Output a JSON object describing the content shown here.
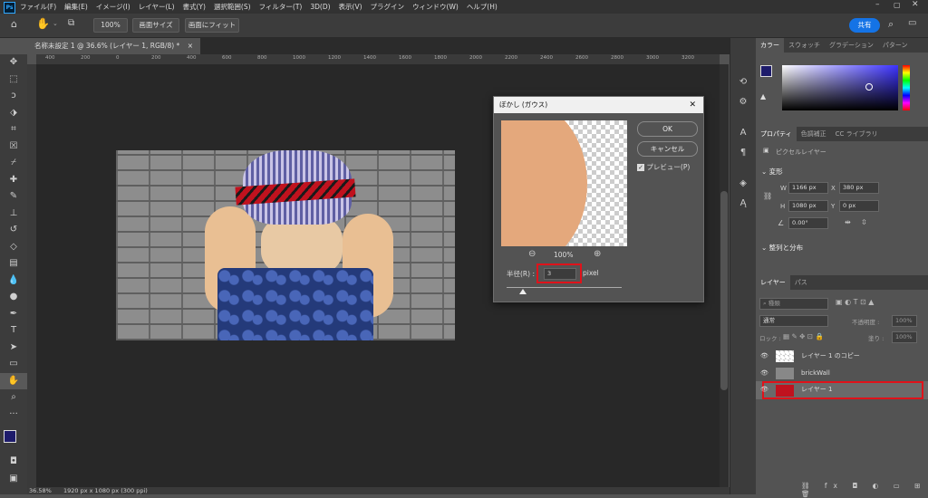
{
  "menubar": {
    "app_icon": "Ps",
    "items": [
      "ファイル(F)",
      "編集(E)",
      "イメージ(I)",
      "レイヤー(L)",
      "書式(Y)",
      "選択範囲(S)",
      "フィルター(T)",
      "3D(D)",
      "表示(V)",
      "プラグイン",
      "ウィンドウ(W)",
      "ヘルプ(H)"
    ]
  },
  "optionsbar": {
    "zoom": "100%",
    "fit_screen": "画面サイズ",
    "fill_screen": "画面にフィット",
    "share": "共有"
  },
  "document": {
    "tab_title": "名称未設定 1 @ 36.6% (レイヤー 1, RGB/8) *",
    "close": "×"
  },
  "ruler": {
    "top_ticks": [
      "400",
      "200",
      "0",
      "200",
      "400",
      "600",
      "800",
      "1000",
      "1200",
      "1400",
      "1600",
      "1800",
      "2000",
      "2200",
      "2400",
      "2600",
      "2800",
      "3000",
      "3200"
    ]
  },
  "status": {
    "zoom": "36.58%",
    "doc_info": "1920 px x 1080 px (300 ppi)"
  },
  "dialog": {
    "title": "ぼかし (ガウス)",
    "close": "✕",
    "ok": "OK",
    "cancel": "キャンセル",
    "preview_label": "プレビュー(P)",
    "preview_checked": true,
    "zoom": "100%",
    "radius_label": "半径(R) :",
    "radius_value": "3",
    "radius_unit": "pixel",
    "slider_value": 3
  },
  "color_panel": {
    "tabs": [
      "カラー",
      "スウォッチ",
      "グラデーション",
      "パターン"
    ],
    "active": "カラー",
    "hue_color": "#3d33ff"
  },
  "properties_panel": {
    "tabs": [
      "プロパティ",
      "色調補正",
      "CC ライブラリ"
    ],
    "type_label": "ピクセルレイヤー",
    "transform_label": "変形",
    "w_label": "W",
    "w_value": "1166 px",
    "h_label": "H",
    "h_value": "1080 px",
    "x_label": "X",
    "x_value": "380 px",
    "y_label": "Y",
    "y_value": "0 px",
    "angle_value": "0.00°",
    "align_label": "整列と分布"
  },
  "layers_panel": {
    "tabs": [
      "レイヤー",
      "パス"
    ],
    "search_placeholder": "種類",
    "blend_mode": "通常",
    "opacity_label": "不透明度 :",
    "opacity_value": "100%",
    "lock_label": "ロック :",
    "fill_label": "塗り :",
    "fill_value": "100%",
    "layers": [
      {
        "name": "レイヤー 1 のコピー",
        "selected": false
      },
      {
        "name": "brickWall",
        "selected": false
      },
      {
        "name": "レイヤー 1",
        "selected": true
      }
    ]
  }
}
